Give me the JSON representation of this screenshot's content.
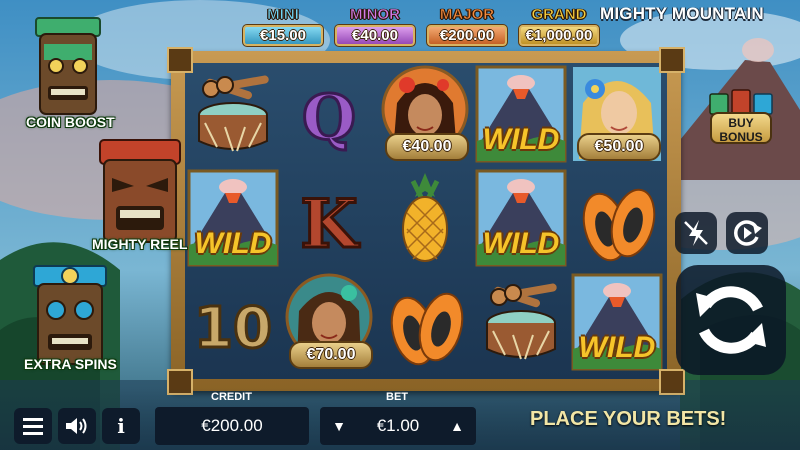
{
  "game": {
    "title": "MIGHTY MOUNTAIN"
  },
  "jackpots": [
    {
      "name": "MINI",
      "value": "€15.00"
    },
    {
      "name": "MINOR",
      "value": "€40.00"
    },
    {
      "name": "MAJOR",
      "value": "€200.00"
    },
    {
      "name": "GRAND",
      "value": "€1,000.00"
    }
  ],
  "features": {
    "coin_boost": "COIN BOOST",
    "mighty_reel": "MIGHTY REEL",
    "extra_spins": "EXTRA SPINS"
  },
  "buy_bonus": {
    "label_line1": "BUY",
    "label_line2": "BONUS"
  },
  "reels": {
    "wild_text": "WILD",
    "grid": [
      [
        "drum",
        "Q",
        "girl-red",
        "wild",
        "girl-blonde"
      ],
      [
        "wild",
        "K",
        "pineapple",
        "wild",
        "papaya"
      ],
      [
        "10",
        "girl-brunette",
        "papaya",
        "drum",
        "wild"
      ]
    ],
    "coin_values": {
      "r0c2": "€40.00",
      "r0c4": "€50.00",
      "r2c1": "€70.00"
    },
    "letters": {
      "q": "Q",
      "k": "K",
      "ten": "10"
    }
  },
  "controls": {
    "credit_label": "CREDIT",
    "credit_value": "€200.00",
    "bet_label": "BET",
    "bet_value": "€1.00",
    "bet_down": "▼",
    "bet_up": "▲",
    "info_label": "i",
    "status": "PLACE YOUR BETS!"
  },
  "colors": {
    "frame_wood": "#b6883f",
    "reel_bg": "#24466a",
    "button_bg": "#0e1b2b",
    "wild_gold": "#f6c42a",
    "status_text": "#f2e6a6"
  }
}
